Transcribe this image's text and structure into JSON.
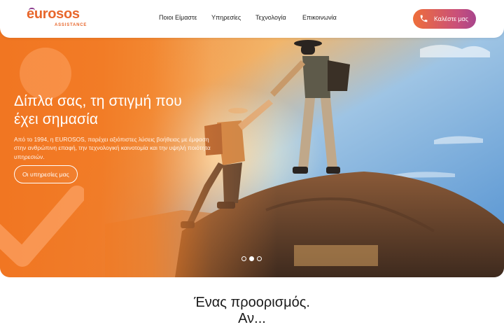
{
  "brand": {
    "name": "eurosos",
    "tagline": "ASSISTANCE",
    "color": "#e8672c",
    "accent": "#8c3c8e"
  },
  "nav": {
    "items": [
      {
        "label": "Ποιοι Είμαστε"
      },
      {
        "label": "Υπηρεσίες"
      },
      {
        "label": "Τεχνολογία"
      },
      {
        "label": "Επικοινωνία"
      }
    ]
  },
  "cta": {
    "label": "Καλέστε μας",
    "icon": "phone-icon"
  },
  "hero": {
    "title_line1": "Δίπλα σας, τη στιγμή που",
    "title_line2": "έχει σημασία",
    "subtitle": "Από το 1994, η EUROSOS, παρέχει αξιόπιστες λύσεις βοήθειας με έμφαση στην ανθρώπινη επαφή, την τεχνολογική καινοτομία και την υψηλή ποιότητα υπηρεσιών.",
    "button_label": "Οι υπηρεσίες μας",
    "slides": 3,
    "active_slide": 2,
    "overlay_color": "#f17622"
  },
  "section": {
    "title_line1": "Ένας προορισμός.",
    "title_line2": "Αν..."
  }
}
